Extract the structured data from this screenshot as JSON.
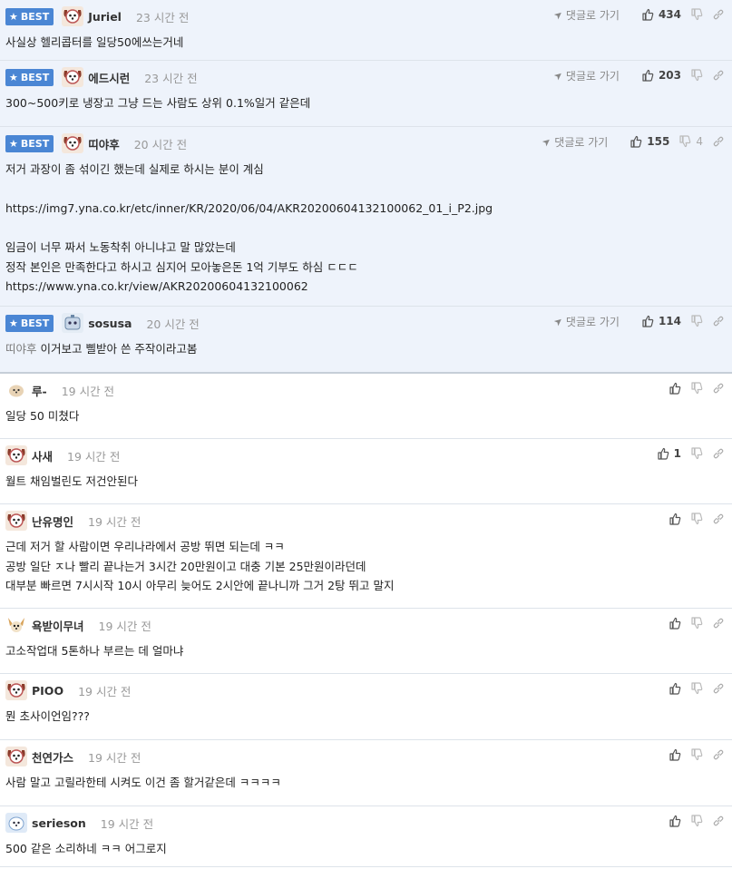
{
  "best_label": "BEST",
  "reply_label": "댓글로 가기",
  "comments": [
    {
      "best": true,
      "author": "Juriel",
      "time": "23 시간 전",
      "likes": "434",
      "dislikes": "",
      "lines": [
        "사실상 헬리콥터를 일당50에쓰는거네"
      ],
      "avatar": "dog-red"
    },
    {
      "best": true,
      "author": "에드시런",
      "time": "23 시간 전",
      "likes": "203",
      "dislikes": "",
      "lines": [
        "300~500키로 냉장고 그냥 드는 사람도 상위 0.1%일거 같은데"
      ],
      "avatar": "dog-red"
    },
    {
      "best": true,
      "author": "띠야후",
      "time": "20 시간 전",
      "likes": "155",
      "dislikes": "4",
      "lines": [
        "저거 과장이 좀 섞이긴 했는데 실제로 하시는 분이 계심",
        "",
        "https://img7.yna.co.kr/etc/inner/KR/2020/06/04/AKR20200604132100062_01_i_P2.jpg",
        "",
        "임금이 너무 짜서 노동착취 아니냐고 말 많았는데",
        "정작 본인은 만족한다고 하시고 심지어 모아놓은돈 1억 기부도 하심 ㄷㄷㄷ",
        "https://www.yna.co.kr/view/AKR20200604132100062"
      ],
      "avatar": "dog-red"
    },
    {
      "best": true,
      "author": "sosusa",
      "time": "20 시간 전",
      "likes": "114",
      "dislikes": "",
      "mention": "띠야후",
      "lines": [
        "이거보고 삘받아 쓴 주작이라고봄"
      ],
      "avatar": "robot"
    },
    {
      "best": false,
      "author": "루-",
      "time": "19 시간 전",
      "likes": "",
      "dislikes": "",
      "lines": [
        "일당 50 미쳤다"
      ],
      "avatar": "pup"
    },
    {
      "best": false,
      "author": "사새",
      "time": "19 시간 전",
      "likes": "1",
      "dislikes": "",
      "lines": [
        "월트 채임벌린도 저건안된다"
      ],
      "avatar": "dog-red"
    },
    {
      "best": false,
      "author": "난유명인",
      "time": "19 시간 전",
      "likes": "",
      "dislikes": "",
      "lines": [
        "근데 저거 할 사람이면 우리나라에서 공방 뛰면 되는데 ㅋㅋ",
        "공방 일단 ㅈ나 빨리 끝나는거 3시간 20만원이고 대충 기본 25만원이라던데",
        "대부분 빠르면 7시시작 10시 아무리 늦어도 2시안에 끝나니까 그거 2탕 뛰고 말지"
      ],
      "avatar": "dog-red"
    },
    {
      "best": false,
      "author": "욕받이무녀",
      "time": "19 시간 전",
      "likes": "",
      "dislikes": "",
      "lines": [
        "고소작업대 5톤하나 부르는 데 얼마냐"
      ],
      "avatar": "chihuahua"
    },
    {
      "best": false,
      "author": "PIOO",
      "time": "19 시간 전",
      "likes": "",
      "dislikes": "",
      "lines": [
        "뭔 초사이언임???"
      ],
      "avatar": "dog-red"
    },
    {
      "best": false,
      "author": "천연가스",
      "time": "19 시간 전",
      "likes": "",
      "dislikes": "",
      "lines": [
        "사람 말고 고릴라한테 시켜도 이건 좀 할거같은데 ㅋㅋㅋㅋ"
      ],
      "avatar": "dog-red"
    },
    {
      "best": false,
      "author": "serieson",
      "time": "19 시간 전",
      "likes": "",
      "dislikes": "",
      "lines": [
        "500 같은 소리하네 ㅋㅋ 어그로지"
      ],
      "avatar": "blue-dog"
    }
  ],
  "colors": {
    "best_bg": "#eef3fb",
    "badge": "#4a86d4",
    "meta": "#999999"
  }
}
